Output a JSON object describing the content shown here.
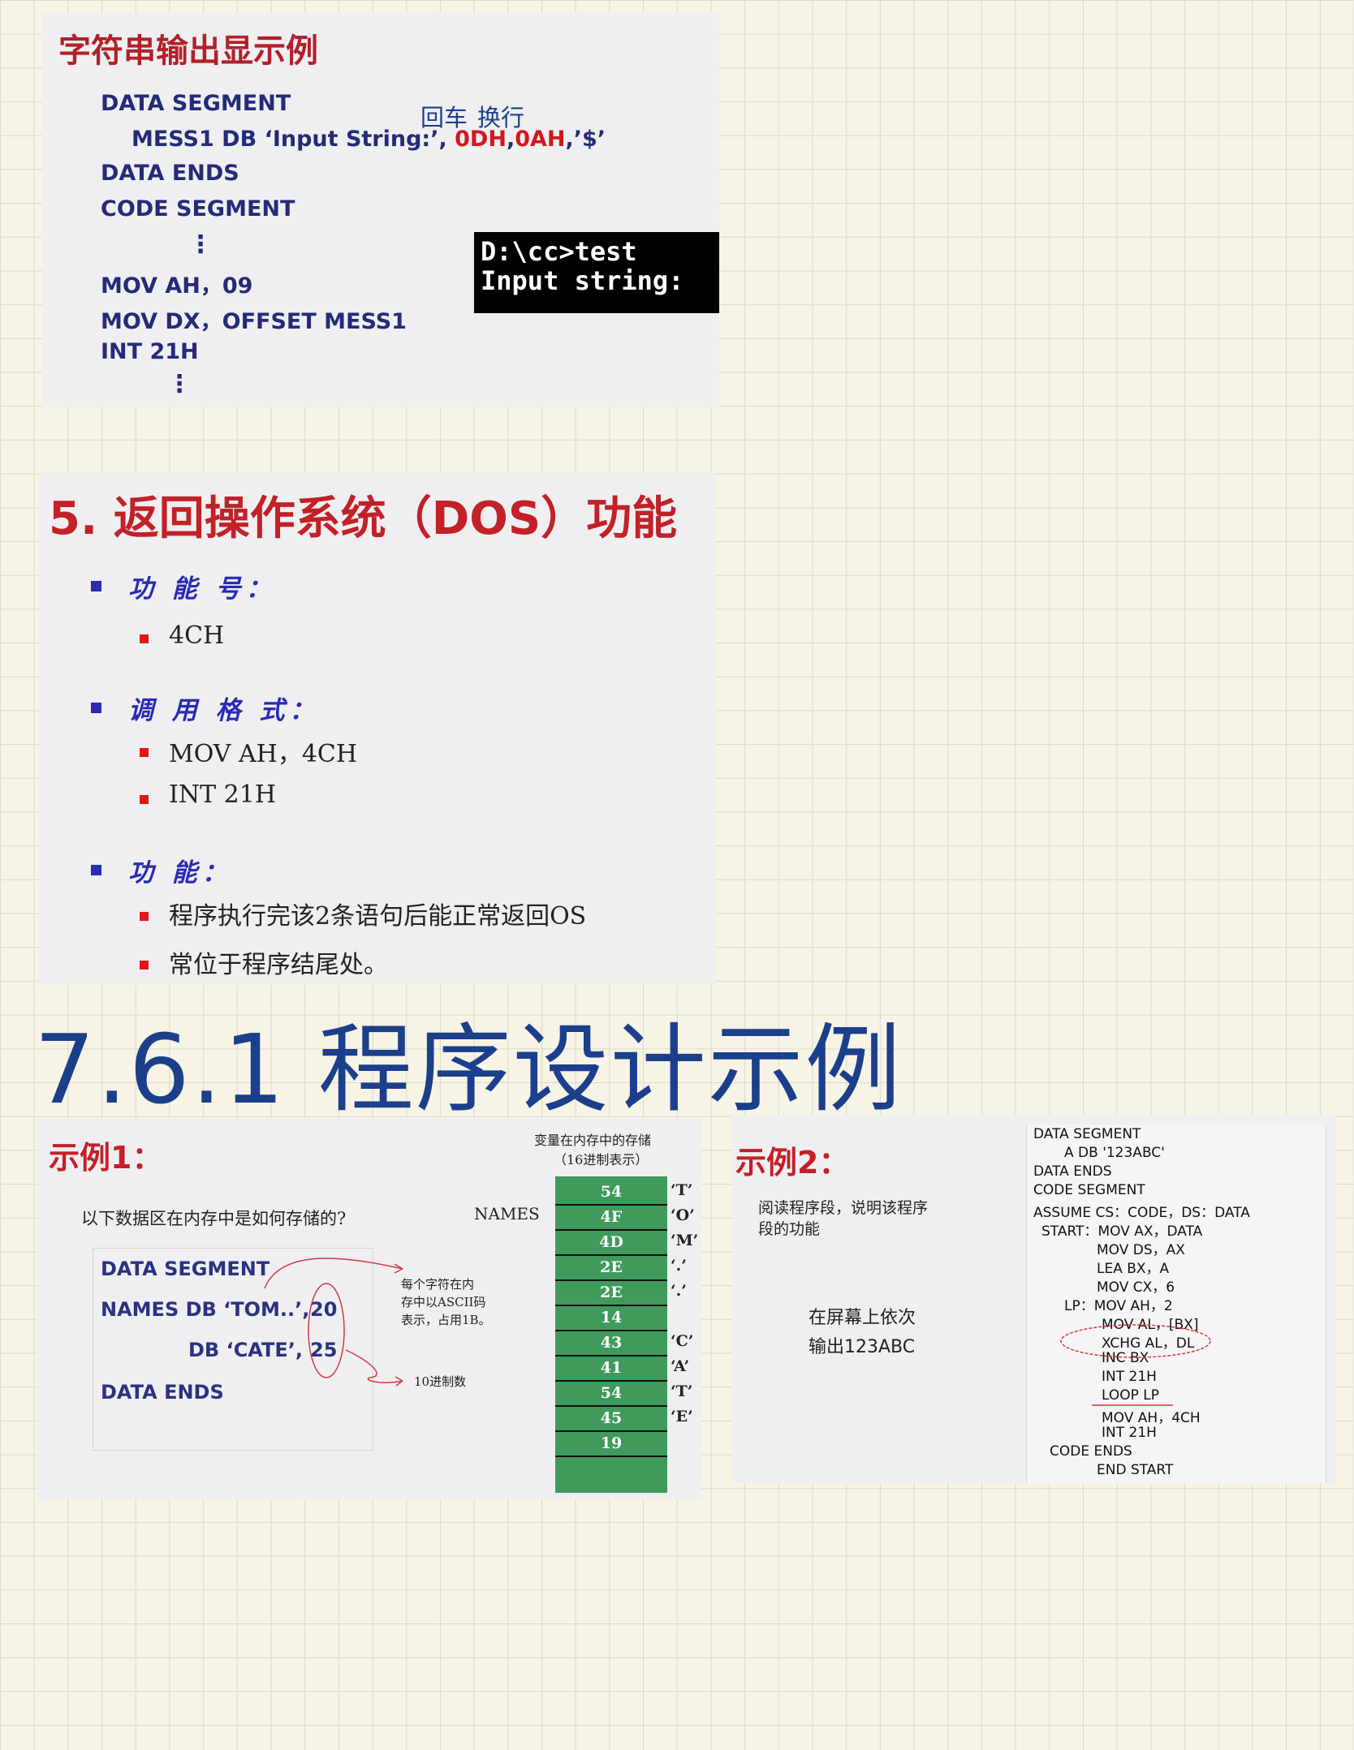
{
  "card1": {
    "title": "字符串输出显示例",
    "lines": [
      "DATA   SEGMENT",
      "DATA  ENDS",
      "CODE  SEGMENT",
      "MOV    AH，09",
      "MOV    DX，OFFSET  MESS1",
      "INT     21H"
    ],
    "mess_prefix": "MESS1  DB  ‘Input String:’, ",
    "mess_odh": "0DH",
    "mess_comma": ",",
    "mess_oah": "0AH",
    "mess_suffix": ",’$’",
    "ann_cr": "回车",
    "ann_lf": "换行",
    "terminal": [
      "D:\\cc>test",
      "Input string:"
    ]
  },
  "card2": {
    "title": "5. 返回操作系统（DOS）功能",
    "sections": [
      {
        "label": "功 能 号：",
        "items": [
          "4CH"
        ]
      },
      {
        "label": "调 用 格 式：",
        "items": [
          "MOV  AH，4CH",
          "INT  21H"
        ]
      },
      {
        "label": "功 能：",
        "items": [
          "程序执行完该2条语句后能正常返回OS",
          "常位于程序结尾处。"
        ]
      }
    ]
  },
  "heading": "7.6.1 程序设计示例",
  "card3": {
    "title": "示例1：",
    "question": "以下数据区在内存中是如何存储的?",
    "mem_caption": [
      "变量在内存中的存储",
      "（16进制表示）"
    ],
    "names_label": "NAMES",
    "code": [
      "DATA SEGMENT",
      "NAMES  DB ‘TOM..’,",
      "DB ‘CATE’,",
      "DATA ENDS"
    ],
    "num20": "20",
    "num25": "25",
    "note_ascii": [
      "每个字符在内",
      "存中以ASCII码",
      "表示，占用1B。"
    ],
    "note_dec": "10进制数",
    "cells": [
      "54",
      "4F",
      "4D",
      "2E",
      "2E",
      "14",
      "43",
      "41",
      "54",
      "45",
      "19"
    ],
    "chars": [
      "‘T’",
      "‘O’",
      "‘M’",
      "‘.’",
      "‘.’",
      "",
      "‘C’",
      "‘A’",
      "‘T’",
      "‘E’",
      ""
    ]
  },
  "card4": {
    "title": "示例2：",
    "question": [
      "阅读程序段，说明该程序",
      "段的功能"
    ],
    "answer": [
      "在屏幕上依次",
      "输出123ABC"
    ],
    "code": [
      "DATA SEGMENT",
      "A  DB '123ABC'",
      "DATA ENDS",
      "CODE SEGMENT",
      "ASSUME CS：CODE，DS：DATA",
      "START：MOV  AX，DATA",
      "MOV  DS，AX",
      "LEA   BX，A",
      "MOV  CX，6",
      "LP：MOV  AH，2",
      "MOV  AL，[BX]",
      "XCHG  AL，DL",
      "INC  BX",
      "INT  21H",
      "LOOP  LP",
      "MOV AH，4CH",
      "INT  21H",
      "CODE  ENDS",
      "END    START"
    ]
  }
}
